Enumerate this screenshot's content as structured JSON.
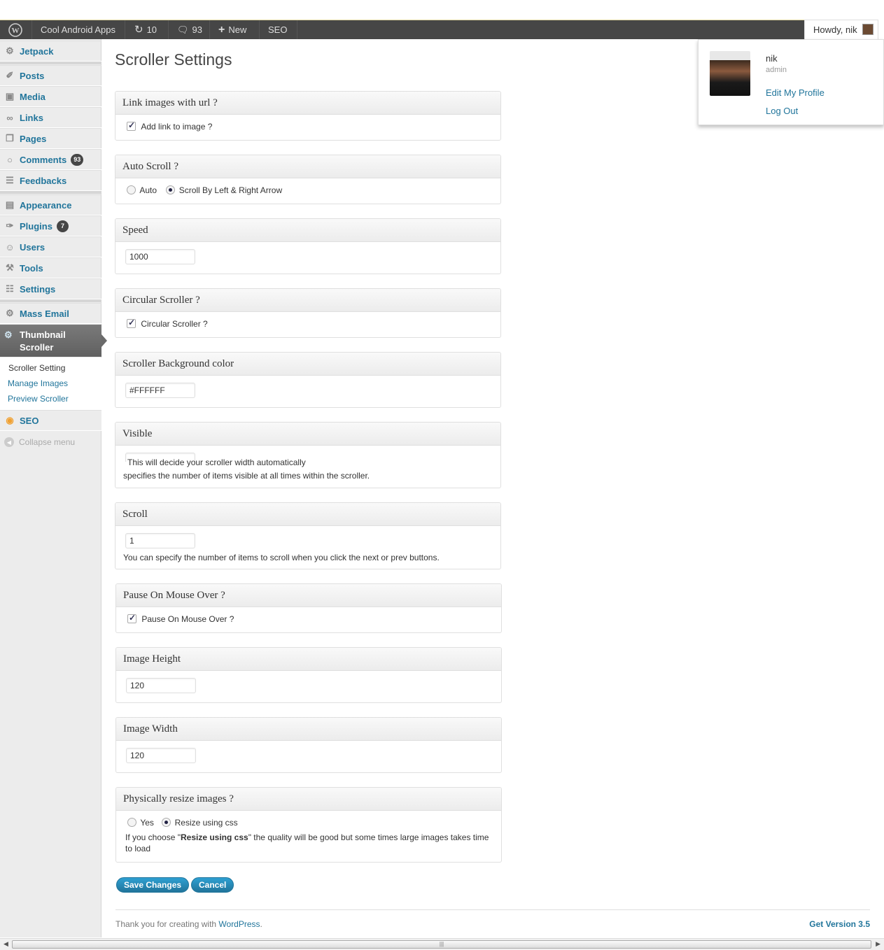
{
  "adminbar": {
    "site": "Cool Android Apps",
    "updates": "10",
    "comments": "93",
    "new_label": "New",
    "seo_label": "SEO",
    "howdy": "Howdy, nik"
  },
  "user_popup": {
    "name": "nik",
    "role": "admin",
    "edit_profile": "Edit My Profile",
    "logout": "Log Out"
  },
  "sidebar": {
    "items": [
      {
        "label": "Jetpack",
        "icon": "jetpack-icon"
      },
      {
        "label": "Posts",
        "icon": "pin-icon"
      },
      {
        "label": "Media",
        "icon": "media-icon"
      },
      {
        "label": "Links",
        "icon": "link-icon"
      },
      {
        "label": "Pages",
        "icon": "pages-icon"
      },
      {
        "label": "Comments",
        "icon": "comment-icon",
        "badge": "93"
      },
      {
        "label": "Feedbacks",
        "icon": "feedback-icon"
      },
      {
        "label": "Appearance",
        "icon": "appearance-icon"
      },
      {
        "label": "Plugins",
        "icon": "plugin-icon",
        "badge": "7"
      },
      {
        "label": "Users",
        "icon": "users-icon"
      },
      {
        "label": "Tools",
        "icon": "tools-icon"
      },
      {
        "label": "Settings",
        "icon": "settings-icon"
      },
      {
        "label": "Mass Email",
        "icon": "gear-icon"
      },
      {
        "label": "SEO",
        "icon": "seo-icon"
      }
    ],
    "active": "Thumbnail Scroller",
    "submenu": [
      "Scroller Setting",
      "Manage Images",
      "Preview Scroller"
    ],
    "collapse": "Collapse menu"
  },
  "page": {
    "title": "Scroller Settings"
  },
  "settings": {
    "link_images": {
      "title": "Link images with url ?",
      "checkbox": "Add link to image ?",
      "checked": true
    },
    "auto_scroll": {
      "title": "Auto Scroll ?",
      "opt1": "Auto",
      "opt2": "Scroll By Left & Right Arrow",
      "selected": "Scroll By Left & Right Arrow"
    },
    "speed": {
      "title": "Speed",
      "value": "1000"
    },
    "circular": {
      "title": "Circular Scroller ?",
      "checkbox": "Circular Scroller ?",
      "checked": true
    },
    "bg_color": {
      "title": "Scroller Background color",
      "value": "#FFFFFF"
    },
    "visible": {
      "title": "Visible",
      "note": "This will decide your scroller width automatically",
      "desc": "specifies the number of items visible at all times within the scroller."
    },
    "scroll": {
      "title": "Scroll",
      "value": "1",
      "desc": "You can specify the number of items to scroll when you click the next or prev buttons."
    },
    "pause": {
      "title": "Pause On Mouse Over ?",
      "checkbox": "Pause On Mouse Over ?",
      "checked": true
    },
    "img_height": {
      "title": "Image Height",
      "value": "120"
    },
    "img_width": {
      "title": "Image Width",
      "value": "120"
    },
    "resize": {
      "title": "Physically resize images ?",
      "opt1": "Yes",
      "opt2": "Resize using css",
      "selected": "Resize using css",
      "desc_pre": "If you choose \"",
      "desc_bold": "Resize using css",
      "desc_post": "\" the quality will be good but some times large images takes time to load"
    }
  },
  "buttons": {
    "save": "Save Changes",
    "cancel": "Cancel"
  },
  "footer": {
    "thanks": "Thank you for creating with ",
    "wp_link": "WordPress",
    "period": ".",
    "version": "Get Version 3.5"
  },
  "colors": {
    "link": "#21759b",
    "adminbar": "#464646",
    "active_menu": "#6a6a6a"
  }
}
